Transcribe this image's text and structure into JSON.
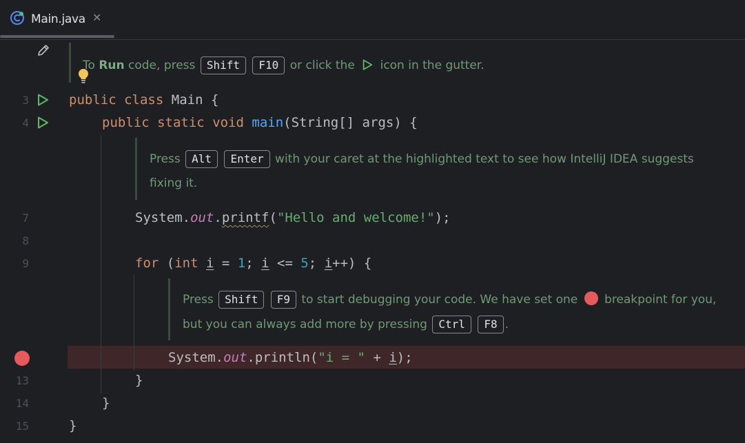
{
  "tab": {
    "filename": "Main.java",
    "close_glyph": "✕",
    "icon": "java-class-icon"
  },
  "gutter": {
    "line_numbers": [
      "3",
      "4",
      "7",
      "8",
      "9",
      "13",
      "14",
      "15"
    ]
  },
  "doc1": {
    "prefix": "To ",
    "run_word": "Run",
    "mid1": " code, press ",
    "key1": "Shift",
    "key2": "F10",
    "mid2": " or click the ",
    "mid3": " icon in the gutter."
  },
  "doc2": {
    "prefix": "Press ",
    "key1": "Alt",
    "key2": "Enter",
    "mid": " with your caret at the highlighted text to see how IntelliJ IDEA suggests",
    "line2": "fixing it."
  },
  "doc3": {
    "prefix": "Press ",
    "key1": "Shift",
    "key2": "F9",
    "mid": " to start debugging your code. We have set one ",
    "end": " breakpoint for you,",
    "line2": "but you can always add more by pressing ",
    "key3": "Ctrl",
    "key4": "F8",
    "line2_end": "."
  },
  "code": {
    "l3": {
      "kw1": "public",
      "kw2": "class",
      "name": "Main",
      "brace": "{"
    },
    "l4": {
      "kw1": "public",
      "kw2": "static",
      "kw3": "void",
      "fn": "main",
      "params": "(String[] args) {"
    },
    "l7": {
      "obj": "System.",
      "field": "out",
      "dot": ".",
      "method": "printf",
      "open": "(",
      "str": "\"Hello and welcome!\"",
      "close": ");"
    },
    "l9": {
      "kw": "for",
      "p1": " (",
      "kw2": "int",
      "sp": " ",
      "var1": "i",
      "p2": " = ",
      "n1": "1",
      "p3": "; ",
      "var2": "i",
      "p4": " <= ",
      "n2": "5",
      "p5": "; ",
      "var3": "i",
      "p6": "++) {"
    },
    "l12": {
      "obj": "System.",
      "field": "out",
      "rest": ".println(",
      "str": "\"i = \"",
      "plus": " + ",
      "var": "i",
      "close": ");"
    },
    "l13": "}",
    "l14": "}",
    "l15": "}"
  },
  "colors": {
    "background": "#1e1f22",
    "keyword": "#cf8e6d",
    "function": "#56a8f5",
    "string": "#6aab73",
    "number": "#2aacb8",
    "field": "#c77dbb",
    "breakpoint": "#e55b5b",
    "breakpoint_line": "#3f2729",
    "doc_text": "#6f9a76"
  }
}
